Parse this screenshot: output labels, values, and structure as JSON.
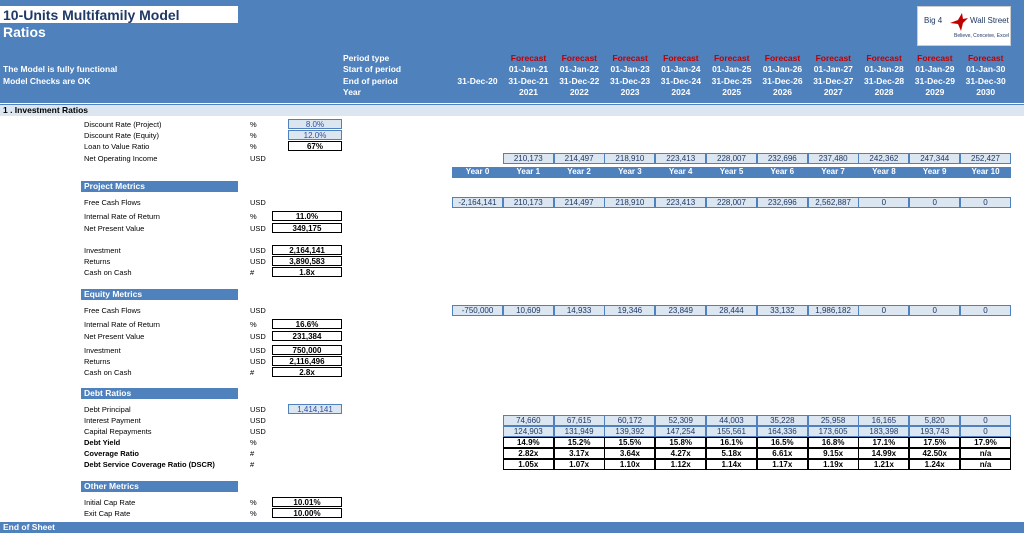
{
  "header": {
    "title": "10-Units Multifamily Model",
    "subtitle": "Ratios",
    "status1": "The Model is fully functional",
    "status2": "Model Checks are OK",
    "period_type_label": "Period type",
    "start_label": "Start of period",
    "end_label": "End of period",
    "year_label": "Year",
    "base_end": "31-Dec-20",
    "periods": [
      {
        "type": "Forecast",
        "start": "01-Jan-21",
        "end": "31-Dec-21",
        "year": "2021"
      },
      {
        "type": "Forecast",
        "start": "01-Jan-22",
        "end": "31-Dec-22",
        "year": "2022"
      },
      {
        "type": "Forecast",
        "start": "01-Jan-23",
        "end": "31-Dec-23",
        "year": "2023"
      },
      {
        "type": "Forecast",
        "start": "01-Jan-24",
        "end": "31-Dec-24",
        "year": "2024"
      },
      {
        "type": "Forecast",
        "start": "01-Jan-25",
        "end": "31-Dec-25",
        "year": "2025"
      },
      {
        "type": "Forecast",
        "start": "01-Jan-26",
        "end": "31-Dec-26",
        "year": "2026"
      },
      {
        "type": "Forecast",
        "start": "01-Jan-27",
        "end": "31-Dec-27",
        "year": "2027"
      },
      {
        "type": "Forecast",
        "start": "01-Jan-28",
        "end": "31-Dec-28",
        "year": "2028"
      },
      {
        "type": "Forecast",
        "start": "01-Jan-29",
        "end": "31-Dec-29",
        "year": "2029"
      },
      {
        "type": "Forecast",
        "start": "01-Jan-30",
        "end": "31-Dec-30",
        "year": "2030"
      }
    ]
  },
  "logo": {
    "line1": "Big 4",
    "line2": "Wall Street",
    "tagline": "Believe, Conceive, Excel",
    "accent": "#c00000"
  },
  "section1": "1 .  Investment Ratios",
  "inputs": [
    {
      "label": "Discount Rate (Project)",
      "unit": "%",
      "value": "8.0%"
    },
    {
      "label": "Discount Rate (Equity)",
      "unit": "%",
      "value": "12.0%"
    },
    {
      "label": "Loan to Value Ratio",
      "unit": "%",
      "value": "67%"
    },
    {
      "label": "Net Operating Income",
      "unit": "USD"
    }
  ],
  "noi_values": [
    "210,173",
    "214,497",
    "218,910",
    "223,413",
    "228,007",
    "232,696",
    "237,480",
    "242,362",
    "247,344",
    "252,427"
  ],
  "years": [
    "Year 0",
    "Year 1",
    "Year 2",
    "Year 3",
    "Year 4",
    "Year 5",
    "Year 6",
    "Year 7",
    "Year 8",
    "Year 9",
    "Year 10"
  ],
  "project": {
    "title": "Project Metrics",
    "fcf_label": "Free Cash Flows",
    "fcf_unit": "USD",
    "fcf": [
      "-2,164,141",
      "210,173",
      "214,497",
      "218,910",
      "223,413",
      "228,007",
      "232,696",
      "2,562,887",
      "0",
      "0",
      "0"
    ],
    "irr_label": "Internal Rate of Return",
    "irr_unit": "%",
    "irr": "11.0%",
    "npv_label": "Net Present Value",
    "npv_unit": "USD",
    "npv": "349,175",
    "inv_label": "Investment",
    "inv_unit": "USD",
    "inv": "2,164,141",
    "ret_label": "Returns",
    "ret_unit": "USD",
    "ret": "3,890,583",
    "coc_label": "Cash on Cash",
    "coc_unit": "#",
    "coc": "1.8x"
  },
  "equity": {
    "title": "Equity Metrics",
    "fcf_label": "Free Cash Flows",
    "fcf_unit": "USD",
    "fcf": [
      "-750,000",
      "10,609",
      "14,933",
      "19,346",
      "23,849",
      "28,444",
      "33,132",
      "1,986,182",
      "0",
      "0",
      "0"
    ],
    "irr_label": "Internal Rate of Return",
    "irr_unit": "%",
    "irr": "16.6%",
    "npv_label": "Net Present Value",
    "npv_unit": "USD",
    "npv": "231,384",
    "inv_label": "Investment",
    "inv_unit": "USD",
    "inv": "750,000",
    "ret_label": "Returns",
    "ret_unit": "USD",
    "ret": "2,116,496",
    "coc_label": "Cash on Cash",
    "coc_unit": "#",
    "coc": "2.8x"
  },
  "debt": {
    "title": "Debt Ratios",
    "principal_label": "Debt Principal",
    "principal_unit": "USD",
    "principal": "1,414,141",
    "interest_label": "Interest Payment",
    "interest_unit": "USD",
    "interest": [
      "74,660",
      "67,615",
      "60,172",
      "52,309",
      "44,003",
      "35,228",
      "25,958",
      "16,165",
      "5,820",
      "0"
    ],
    "repay_label": "Capital Repayments",
    "repay_unit": "USD",
    "repay": [
      "124,903",
      "131,949",
      "139,392",
      "147,254",
      "155,561",
      "164,336",
      "173,605",
      "183,398",
      "193,743",
      "0"
    ],
    "yield_label": "Debt Yield",
    "yield_unit": "%",
    "yield": [
      "14.9%",
      "15.2%",
      "15.5%",
      "15.8%",
      "16.1%",
      "16.5%",
      "16.8%",
      "17.1%",
      "17.5%",
      "17.9%"
    ],
    "cov_label": "Coverage Ratio",
    "cov_unit": "#",
    "cov": [
      "2.82x",
      "3.17x",
      "3.64x",
      "4.27x",
      "5.18x",
      "6.61x",
      "9.15x",
      "14.99x",
      "42.50x",
      "n/a"
    ],
    "dscr_label": "Debt Service Coverage Ratio (DSCR)",
    "dscr_unit": "#",
    "dscr": [
      "1.05x",
      "1.07x",
      "1.10x",
      "1.12x",
      "1.14x",
      "1.17x",
      "1.19x",
      "1.21x",
      "1.24x",
      "n/a"
    ]
  },
  "other": {
    "title": "Other Metrics",
    "icr_label": "Initial Cap Rate",
    "icr_unit": "%",
    "icr": "10.01%",
    "ecr_label": "Exit Cap Rate",
    "ecr_unit": "%",
    "ecr": "10.00%"
  },
  "end_label": "End of Sheet"
}
